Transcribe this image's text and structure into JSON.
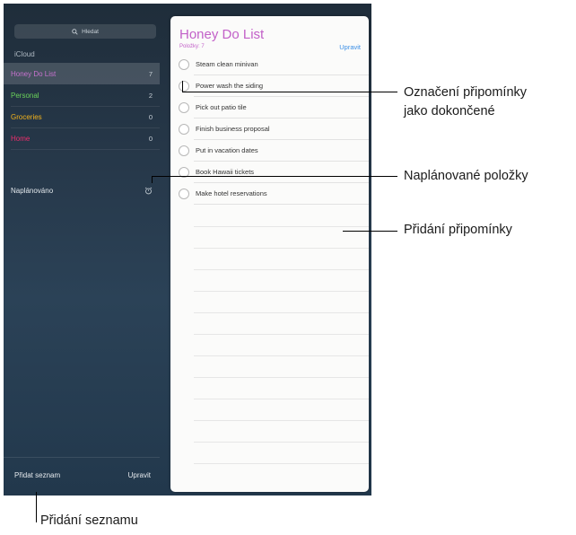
{
  "sidebar": {
    "search_placeholder": "Hledat",
    "section_title": "iCloud",
    "lists": [
      {
        "name": "Honey Do List",
        "count": "7",
        "color": "#c772cf"
      },
      {
        "name": "Personal",
        "count": "2",
        "color": "#6ad15a"
      },
      {
        "name": "Groceries",
        "count": "0",
        "color": "#f2b21c"
      },
      {
        "name": "Home",
        "count": "0",
        "color": "#ec2e6c"
      }
    ],
    "scheduled_label": "Naplánováno",
    "add_list_label": "Přidat seznam",
    "edit_label": "Upravit"
  },
  "panel": {
    "title": "Honey Do List",
    "subtitle": "Položky: 7",
    "edit_label": "Upravit",
    "tasks": [
      "Steam clean minivan",
      "Power wash the siding",
      "Pick out patio tile",
      "Finish business proposal",
      "Put in vacation dates",
      "Book Hawaii tickets",
      "Make hotel reservations"
    ]
  },
  "callouts": {
    "mark_complete_line1": "Označení připomínky",
    "mark_complete_line2": "jako dokončené",
    "scheduled_items": "Naplánované položky",
    "add_reminder": "Přidání připomínky",
    "add_list": "Přidání seznamu"
  }
}
